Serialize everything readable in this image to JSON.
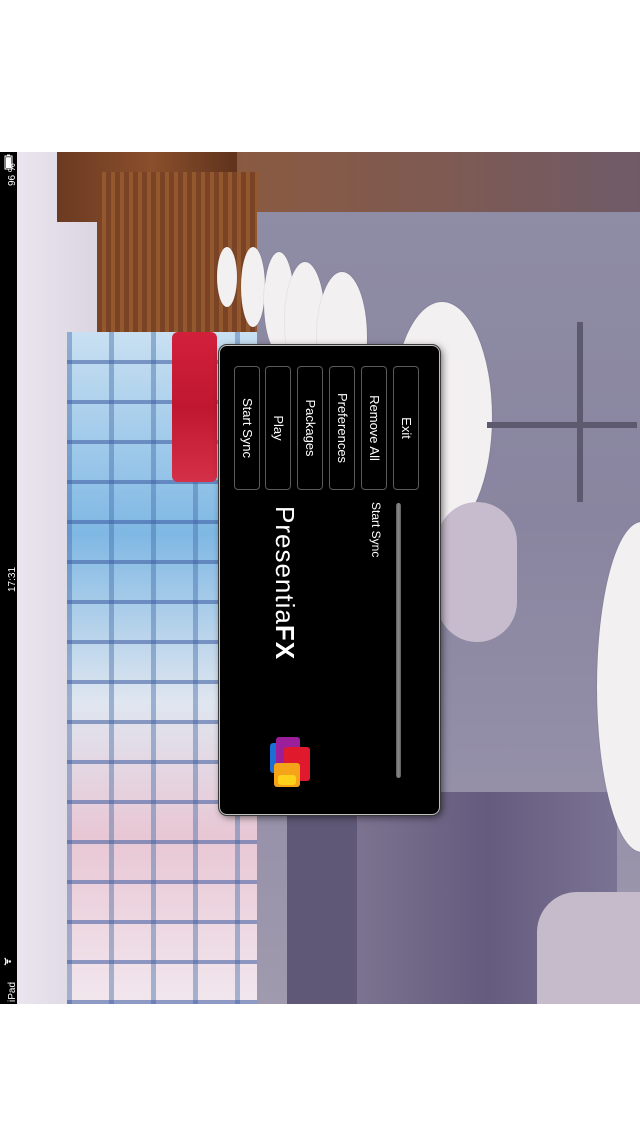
{
  "status_bar": {
    "carrier": "iPad",
    "time": "17:31",
    "battery_percent": "96 %",
    "wifi_icon": "wifi-icon",
    "battery_icon": "battery-icon"
  },
  "app": {
    "logo_main": "Presentia",
    "logo_fx": "FX",
    "menu": [
      {
        "label": "Start Sync"
      },
      {
        "label": "Play"
      },
      {
        "label": "Packages"
      },
      {
        "label": "Preferences"
      },
      {
        "label": "Remove All"
      },
      {
        "label": "Exit"
      }
    ],
    "status_text": "Start Sync",
    "progress": 0
  },
  "colors": {
    "panel": "#000000",
    "text": "#ffffff",
    "logo_blue": "#1b6fd4",
    "logo_purple": "#9b1f9a",
    "logo_red": "#e1192c",
    "logo_orange": "#f5a41a"
  }
}
